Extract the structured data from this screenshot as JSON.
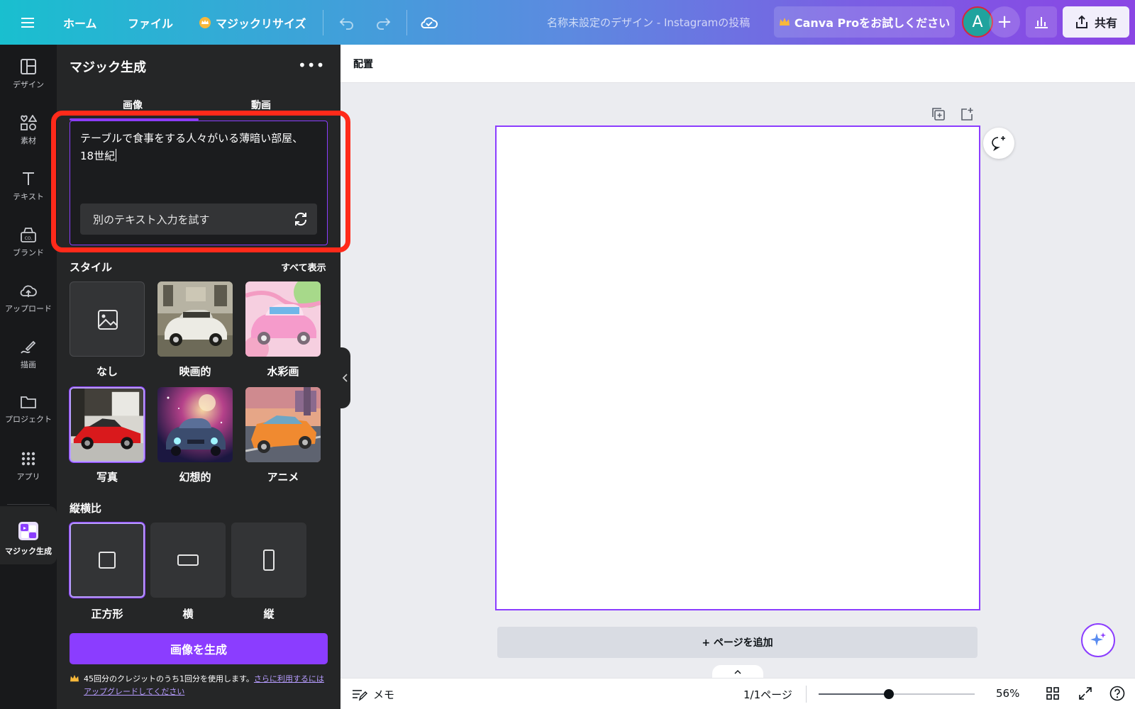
{
  "topbar": {
    "home": "ホーム",
    "file": "ファイル",
    "magic_resize": "マジックリサイズ",
    "doc_title": "名称未設定のデザイン - Instagramの投稿",
    "pro_label": "Canva Proをお試しください",
    "avatar_initial": "A",
    "share": "共有"
  },
  "rail": {
    "design": "デザイン",
    "elements": "素材",
    "text": "テキスト",
    "brand": "ブランド",
    "upload": "アップロード",
    "draw": "描画",
    "projects": "プロジェクト",
    "apps": "アプリ",
    "magic_gen": "マジック生成"
  },
  "panel": {
    "title": "マジック生成",
    "tab_image": "画像",
    "tab_video": "動画",
    "prompt_line1": "テーブルで食事をする人々がいる薄暗い部屋、",
    "prompt_line2": "18世紀",
    "alt_prompt": "別のテキスト入力を試す",
    "style_title": "スタイル",
    "see_all": "すべて表示",
    "styles": [
      "なし",
      "映画的",
      "水彩画",
      "写真",
      "幻想的",
      "アニメ"
    ],
    "selected_style": "写真",
    "ratio_title": "縦横比",
    "ratios": [
      "正方形",
      "横",
      "縦"
    ],
    "selected_ratio": "正方形",
    "generate": "画像を生成",
    "credit_text": "45回分のクレジットのうち1回分を使用します。",
    "credit_link": "さらに利用するにはアップグレードしてください"
  },
  "canvas": {
    "context_label": "配置",
    "add_page": "+ ページを追加"
  },
  "bottombar": {
    "notes": "メモ",
    "page_count": "1/1ページ",
    "zoom_percent": 56,
    "zoom": "56%"
  },
  "colors": {
    "accent": "#8b3dff",
    "highlight": "#ff2a1a",
    "panel_bg": "#252627",
    "rail_bg": "#18191b"
  }
}
